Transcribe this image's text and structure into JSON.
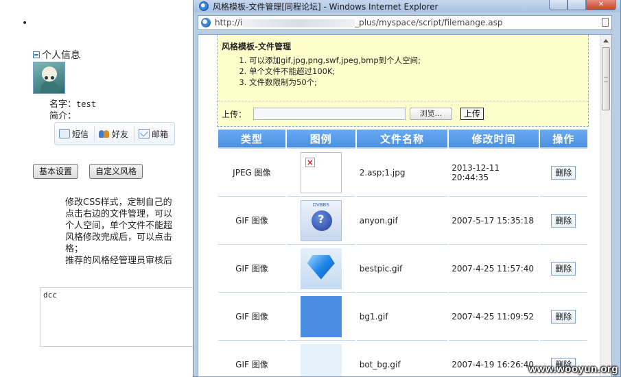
{
  "background": {
    "bullet": "•",
    "profile_heading": "个人信息",
    "name_label": "名字：",
    "name_value": "test",
    "intro_label": "简介：",
    "toolbar": {
      "sms": "短信",
      "friends": "好友",
      "mailbox": "邮箱"
    },
    "buttons": {
      "basic_settings": "基本设置",
      "custom_style": "自定义风格"
    },
    "tips": [
      "修改CSS样式，定制自己的",
      "点击右边的文件管理，可以",
      "个人空间，单个文件不能超",
      "风格修改完成后，可以点击",
      "格；",
      "推荐的风格经管理员审核后"
    ],
    "textarea_value": "dcc"
  },
  "ie_window": {
    "title": "风格模板-文件管理[同程论坛] - Windows Internet Explorer",
    "address_prefix": "http://i",
    "address_suffix": "_plus/myspace/script/filemange.asp"
  },
  "notice": {
    "title": "风格模板-文件管理",
    "items": [
      "可以添加gif,jpg,png,swf,jpeg,bmp到个人空间;",
      "单个文件不能超过100K;",
      "文件数限制为50个;"
    ],
    "upload_label": "上传：",
    "browse_label": "浏览...",
    "upload_button": "上传"
  },
  "table": {
    "headers": [
      "类型",
      "图例",
      "文件名称",
      "修改时间",
      "操作"
    ],
    "rows": [
      {
        "type": "JPEG 图像",
        "thumb": "broken-image",
        "name": "2.asp;1.jpg",
        "time": "2013-12-11 20:44:35",
        "action": "删除"
      },
      {
        "type": "GIF 图像",
        "thumb": "anyon-avatar",
        "thumb_text": "DVBBS",
        "name": "anyon.gif",
        "time": "2007-5-17 15:35:18",
        "action": "删除"
      },
      {
        "type": "GIF 图像",
        "thumb": "diamond-gem",
        "name": "bestpic.gif",
        "time": "2007-4-25 11:57:40",
        "action": "删除"
      },
      {
        "type": "GIF 图像",
        "thumb": "blue-swatch",
        "name": "bg1.gif",
        "time": "2007-4-25 11:09:52",
        "action": "删除"
      },
      {
        "type": "GIF 图像",
        "thumb": "pale-swatch",
        "name": "bot_bg.gif",
        "time": "2007-4-19 16:26:40",
        "action": "删除"
      }
    ]
  },
  "colors": {
    "header_blue": "#4a8fe0",
    "notice_yellow": "#ffffcc",
    "ie_frame": "#b9cde5"
  },
  "watermark": "www.wooyun.org"
}
